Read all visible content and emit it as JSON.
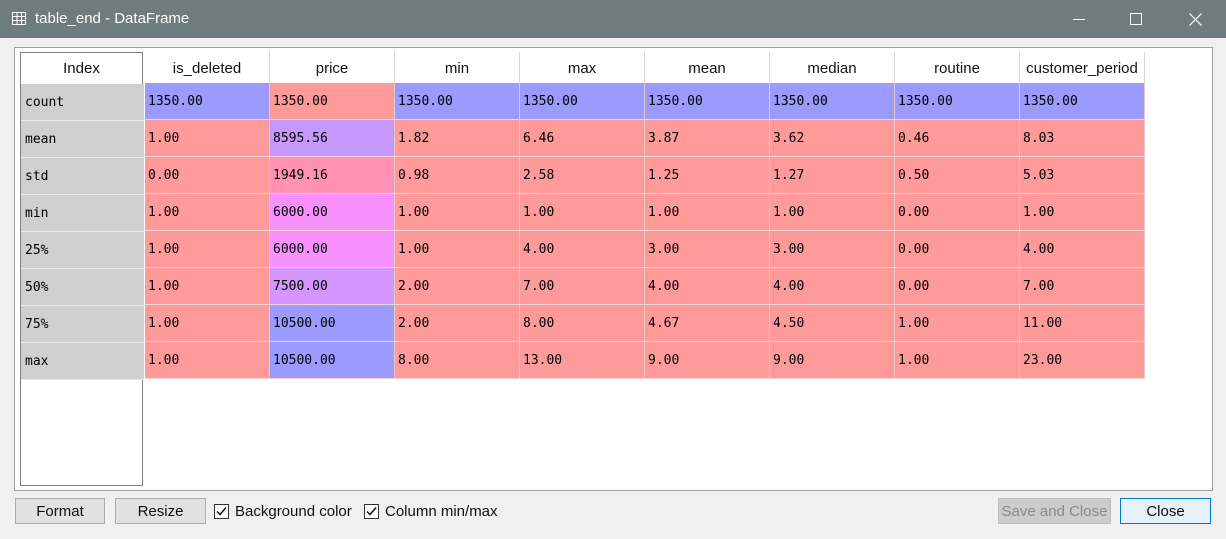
{
  "window": {
    "title": "table_end - DataFrame",
    "minimize_icon": "minimize-icon",
    "maximize_icon": "maximize-icon",
    "close_icon": "close-icon",
    "table_icon": "table-icon",
    "titlebar_color": "#6e7b7f"
  },
  "table": {
    "index_header": "Index",
    "columns": [
      "is_deleted",
      "price",
      "min",
      "max",
      "mean",
      "median",
      "routine",
      "customer_period"
    ],
    "rows": [
      {
        "index": "count",
        "values": [
          "1350.00",
          "1350.00",
          "1350.00",
          "1350.00",
          "1350.00",
          "1350.00",
          "1350.00",
          "1350.00"
        ],
        "colors": [
          "#9a9aff",
          "#ff9a9a",
          "#9a9aff",
          "#9a9aff",
          "#9a9aff",
          "#9a9aff",
          "#9a9aff",
          "#9a9aff"
        ]
      },
      {
        "index": "mean",
        "values": [
          "1.00",
          "8595.56",
          "1.82",
          "6.46",
          "3.87",
          "3.62",
          "0.46",
          "8.03"
        ],
        "colors": [
          "#ff9a9a",
          "#c597ff",
          "#ff9a9a",
          "#ff9a9a",
          "#ff9a9a",
          "#ff9a9a",
          "#ff9a9a",
          "#ff9a9a"
        ]
      },
      {
        "index": "std",
        "values": [
          "0.00",
          "1949.16",
          "0.98",
          "2.58",
          "1.25",
          "1.27",
          "0.50",
          "5.03"
        ],
        "colors": [
          "#ff9a9a",
          "#ff92b4",
          "#ff9a9a",
          "#ff9a9a",
          "#ff9a9a",
          "#ff9a9a",
          "#ff9a9a",
          "#ff9a9a"
        ]
      },
      {
        "index": "min",
        "values": [
          "1.00",
          "6000.00",
          "1.00",
          "1.00",
          "1.00",
          "1.00",
          "0.00",
          "1.00"
        ],
        "colors": [
          "#ff9a9a",
          "#f890ff",
          "#ff9a9a",
          "#ff9a9a",
          "#ff9a9a",
          "#ff9a9a",
          "#ff9a9a",
          "#ff9a9a"
        ]
      },
      {
        "index": "25%",
        "values": [
          "1.00",
          "6000.00",
          "1.00",
          "4.00",
          "3.00",
          "3.00",
          "0.00",
          "4.00"
        ],
        "colors": [
          "#ff9a9a",
          "#f890ff",
          "#ff9a9a",
          "#ff9a9a",
          "#ff9a9a",
          "#ff9a9a",
          "#ff9a9a",
          "#ff9a9a"
        ]
      },
      {
        "index": "50%",
        "values": [
          "1.00",
          "7500.00",
          "2.00",
          "7.00",
          "4.00",
          "4.00",
          "0.00",
          "7.00"
        ],
        "colors": [
          "#ff9a9a",
          "#d696ff",
          "#ff9a9a",
          "#ff9a9a",
          "#ff9a9a",
          "#ff9a9a",
          "#ff9a9a",
          "#ff9a9a"
        ]
      },
      {
        "index": "75%",
        "values": [
          "1.00",
          "10500.00",
          "2.00",
          "8.00",
          "4.67",
          "4.50",
          "1.00",
          "11.00"
        ],
        "colors": [
          "#ff9a9a",
          "#9a9aff",
          "#ff9a9a",
          "#ff9a9a",
          "#ff9a9a",
          "#ff9a9a",
          "#ff9a9a",
          "#ff9a9a"
        ]
      },
      {
        "index": "max",
        "values": [
          "1.00",
          "10500.00",
          "8.00",
          "13.00",
          "9.00",
          "9.00",
          "1.00",
          "23.00"
        ],
        "colors": [
          "#ff9a9a",
          "#9a9aff",
          "#ff9a9a",
          "#ff9a9a",
          "#ff9a9a",
          "#ff9a9a",
          "#ff9a9a",
          "#ff9a9a"
        ]
      }
    ]
  },
  "footer": {
    "format_label": "Format",
    "resize_label": "Resize",
    "background_color_label": "Background color",
    "background_color_checked": true,
    "column_minmax_label": "Column min/max",
    "column_minmax_checked": true,
    "save_close_label": "Save and Close",
    "close_label": "Close"
  }
}
